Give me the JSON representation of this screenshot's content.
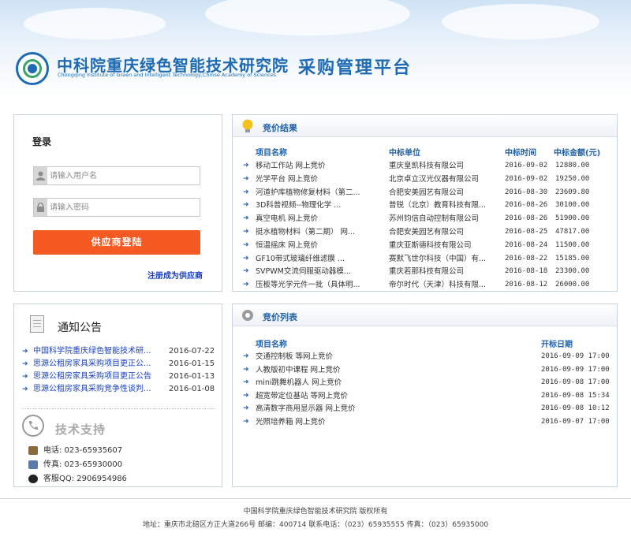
{
  "header": {
    "title_cn": "中科院重庆绿色智能技术研究院",
    "title_en": "Chongqing Institute of Green and Intelligent Technology,Chinse Academy of Sciences",
    "subtitle": "采购管理平台"
  },
  "login": {
    "title": "登录",
    "username_placeholder": "请输入用户名",
    "password_placeholder": "请输入密码",
    "button_label": "供应商登陆",
    "register_link": "注册成为供应商"
  },
  "notices": {
    "title": "通知公告",
    "items": [
      {
        "title": "中国科学院重庆绿色智能技术研...",
        "date": "2016-07-22"
      },
      {
        "title": "思源公租房家具采购项目更正公...",
        "date": "2016-01-15"
      },
      {
        "title": "思源公租房家具采购项目更正公告",
        "date": "2016-01-13"
      },
      {
        "title": "思源公租房家具采购竞争性谈判...",
        "date": "2016-01-08"
      }
    ]
  },
  "support": {
    "title": "技术支持",
    "phone": "电话: 023-65935607",
    "fax": "传真: 023-65930000",
    "qq": "客服QQ: 2906954986"
  },
  "bid_results": {
    "title": "竞价结果",
    "headers": {
      "name": "项目名称",
      "unit": "中标单位",
      "time": "中标时间",
      "amount": "中标金额(元)"
    },
    "rows": [
      {
        "name": "移动工作站 网上竞价",
        "unit": "重庆皇凯科技有限公司",
        "time": "2016-09-02",
        "amount": "12880.00"
      },
      {
        "name": "光学平台 网上竞价",
        "unit": "北京卓立汉光仪器有限公司",
        "time": "2016-09-02",
        "amount": "19250.00"
      },
      {
        "name": "河道护库植物修复材料（第二...",
        "unit": "合肥安美园艺有限公司",
        "time": "2016-08-30",
        "amount": "23609.80"
      },
      {
        "name": "3D科普视频--物理化学 ...",
        "unit": "普锐（北京）教育科技有限...",
        "time": "2016-08-26",
        "amount": "30100.00"
      },
      {
        "name": "真空电机 网上竞价",
        "unit": "苏州钧信自动控制有限公司",
        "time": "2016-08-26",
        "amount": "51900.00"
      },
      {
        "name": "挺水植物材料（第二期） 网...",
        "unit": "合肥安美园艺有限公司",
        "time": "2016-08-25",
        "amount": "47817.00"
      },
      {
        "name": "恒温摇床 网上竞价",
        "unit": "重庆亚斯德科技有限公司",
        "time": "2016-08-24",
        "amount": "11500.00"
      },
      {
        "name": "GF10带式玻璃纤维滤膜 ...",
        "unit": "赛默飞世尔科技（中国）有...",
        "time": "2016-08-22",
        "amount": "15185.00"
      },
      {
        "name": "SVPWM交流伺服驱动器模...",
        "unit": "重庆若那科技有限公司",
        "time": "2016-08-18",
        "amount": "23300.00"
      },
      {
        "name": "压板等光学元件一批（具体明...",
        "unit": "帝尔时代（天津）科技有限...",
        "time": "2016-08-12",
        "amount": "26000.00"
      }
    ]
  },
  "bid_list": {
    "title": "竞价列表",
    "headers": {
      "name": "项目名称",
      "date": "开标日期"
    },
    "rows": [
      {
        "name": "交通控制板 等网上竞价",
        "date": "2016-09-09 17:00"
      },
      {
        "name": "人教版初中课程 网上竞价",
        "date": "2016-09-09 17:00"
      },
      {
        "name": "mini跳舞机器人 网上竞价",
        "date": "2016-09-08 17:00"
      },
      {
        "name": "超宽带定位基站 等网上竞价",
        "date": "2016-09-08 15:34"
      },
      {
        "name": "高清数字商用显示器 网上竞价",
        "date": "2016-09-08 10:12"
      },
      {
        "name": "光照培养箱 网上竞价",
        "date": "2016-09-07 17:00"
      }
    ]
  },
  "footer": {
    "copyright": "中国科学院重庆绿色智能技术研究院 版权所有",
    "address": "地址：重庆市北碚区方正大道266号 邮编：400714  联系电话：（023）65935555 传真：（023）65935000"
  },
  "colors": {
    "brand_blue": "#1f6bb3",
    "login_button": "#f45a22",
    "link_blue": "#1a3fbd"
  }
}
